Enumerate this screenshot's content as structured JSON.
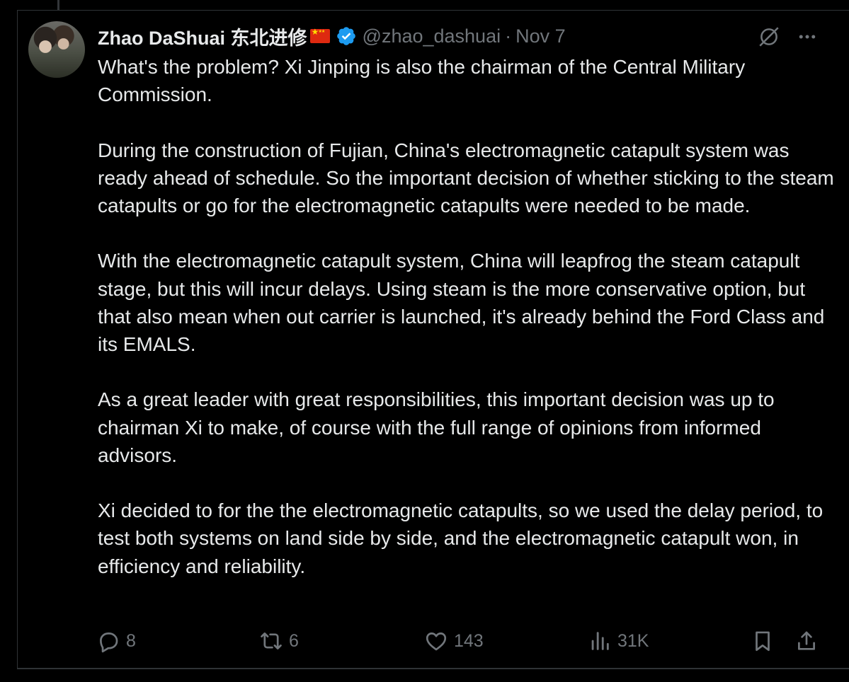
{
  "author": {
    "display_name": "Zhao DaShuai 东北进修",
    "flag_emoji_name": "china-flag-icon",
    "verified": true,
    "handle": "@zhao_dashuai",
    "separator": "·",
    "date": "Nov 7"
  },
  "tweet": {
    "paragraphs": [
      "What's the problem? Xi Jinping is also the chairman of the Central Military Commission.",
      "During the construction of Fujian, China's electromagnetic catapult system was ready ahead of schedule. So the important decision of whether sticking to the steam catapults or go for the electromagnetic catapults were needed to be made.",
      "With the electromagnetic catapult system, China will leapfrog the steam catapult stage, but this will incur delays. Using steam is the more conservative option, but that also mean when out carrier is launched, it's already behind the Ford Class and its EMALS.",
      "As a great leader with great responsibilities, this important decision was up to chairman Xi to make, of course with the full range of opinions from informed advisors.",
      "Xi decided to for the the electromagnetic catapults, so we used the delay period, to test both systems on land side by side, and the electromagnetic catapult won, in efficiency and reliability."
    ]
  },
  "actions": {
    "replies": "8",
    "reposts": "6",
    "likes": "143",
    "views": "31K"
  },
  "icons": {
    "top_right": [
      "grok-icon",
      "more-icon"
    ],
    "bottom": [
      "reply-icon",
      "repost-icon",
      "like-icon",
      "views-icon",
      "bookmark-icon",
      "share-icon"
    ]
  },
  "colors": {
    "background": "#000000",
    "text_primary": "#e7e9ea",
    "text_secondary": "#71767b",
    "divider": "#2f3336",
    "verified_blue": "#1d9bf0"
  }
}
